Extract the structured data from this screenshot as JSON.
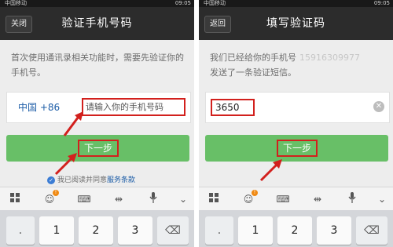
{
  "left_screen": {
    "status": {
      "carrier": "中国移动",
      "time": "09:05"
    },
    "top_button": "关闭",
    "title": "验证手机号码",
    "description": "首次使用通讯录相关功能时，需要先验证你的手机号。",
    "country_code": "中国 +86",
    "phone_placeholder": "请输入你的手机号码",
    "next_label": "下一步",
    "agree_text": "我已阅读并同意",
    "terms_link": "服务条款"
  },
  "right_screen": {
    "status": {
      "carrier": "中国移动",
      "time": "09:05"
    },
    "top_button": "返回",
    "title": "填写验证码",
    "description_1": "我们已经给你的手机号",
    "masked_number": "15916309977",
    "description_2": "发送了一条验证短信。",
    "code_value": "3650",
    "next_label": "下一步"
  },
  "keyboard": {
    "toolbar_icons": [
      "grid-icon",
      "emoji-icon",
      "keyboard-icon",
      "cursor-icon",
      "microphone-icon",
      "chevron-down-icon"
    ],
    "keys": [
      ".",
      "1",
      "2",
      "3"
    ],
    "backspace_icon": "backspace-icon"
  },
  "colors": {
    "titlebar": "#2c2c2c",
    "next_button": "#68bf67",
    "highlight_box": "#d2201d",
    "link_blue": "#1d5da7"
  }
}
